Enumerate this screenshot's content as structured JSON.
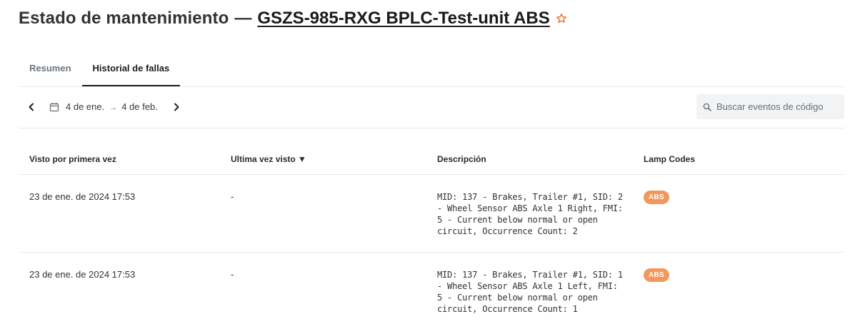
{
  "header": {
    "title_prefix": "Estado de mantenimiento",
    "dash": "—",
    "vehicle_name": "GSZS-985-RXG BPLC-Test-unit ABS",
    "favorite_icon": "star-outline-icon",
    "accent_color": "#e8702a"
  },
  "tabs": [
    {
      "label": "Resumen",
      "active": false
    },
    {
      "label": "Historial de fallas",
      "active": true
    }
  ],
  "toolbar": {
    "prev_icon": "chevron-left-icon",
    "next_icon": "chevron-right-icon",
    "calendar_icon": "calendar-icon",
    "date_from": "4 de ene.",
    "arrow": "→",
    "date_to": "4 de feb.",
    "search_placeholder": "Buscar eventos de código",
    "search_value": ""
  },
  "table": {
    "columns": [
      {
        "label": "Visto por primera vez"
      },
      {
        "label": "Ultima vez visto ▼"
      },
      {
        "label": "Descripción"
      },
      {
        "label": "Lamp Codes"
      }
    ],
    "rows": [
      {
        "first_seen": "23 de ene. de 2024 17:53",
        "last_seen": "-",
        "description": "MID: 137 - Brakes, Trailer #1, SID: 2 - Wheel Sensor ABS Axle 1 Right, FMI: 5 - Current below normal or open circuit, Occurrence Count: 2",
        "lamp_code": "ABS"
      },
      {
        "first_seen": "23 de ene. de 2024 17:53",
        "last_seen": "-",
        "description": "MID: 137 - Brakes, Trailer #1, SID: 1 - Wheel Sensor ABS Axle 1 Left, FMI: 5 - Current below normal or open circuit, Occurrence Count: 1",
        "lamp_code": "ABS"
      }
    ],
    "badge_color": "#f4975a"
  }
}
